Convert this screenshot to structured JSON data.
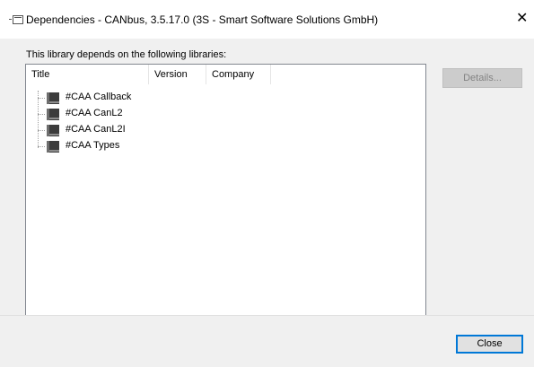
{
  "window": {
    "title": "Dependencies - CANbus, 3.5.17.0 (3S - Smart Software Solutions GmbH)",
    "close_glyph": "✕"
  },
  "main": {
    "caption": "This library depends on the following libraries:",
    "columns": [
      "Title",
      "Version",
      "Company"
    ],
    "libraries": [
      {
        "title": "#CAA Callback",
        "version": "",
        "company": ""
      },
      {
        "title": "#CAA CanL2",
        "version": "",
        "company": ""
      },
      {
        "title": "#CAA CanL2I",
        "version": "",
        "company": ""
      },
      {
        "title": "#CAA Types",
        "version": "",
        "company": ""
      }
    ]
  },
  "buttons": {
    "details": "Details...",
    "close": "Close"
  },
  "icons": {
    "title_icon": "library-window-icon",
    "library_icon": "library-book-icon"
  },
  "colors": {
    "focus_border": "#0078d7",
    "disabled_text": "#838383",
    "dialog_bg": "#f0f0f0"
  }
}
